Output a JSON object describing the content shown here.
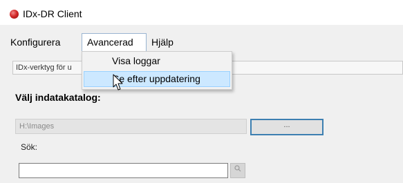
{
  "window": {
    "title": "IDx-DR Client"
  },
  "menubar": {
    "items": [
      {
        "label": "Konfigurera"
      },
      {
        "label": "Avancerad"
      },
      {
        "label": "Hjälp"
      }
    ]
  },
  "dropdown": {
    "items": [
      {
        "label": "Visa loggar",
        "highlighted": false
      },
      {
        "label": "Se efter uppdatering",
        "highlighted": true
      }
    ]
  },
  "toolstrip": {
    "text": "IDx-verktyg för u"
  },
  "main": {
    "section_label": "Välj indatakatalog:",
    "path_value": "H:\\Images",
    "browse_label": "...",
    "search_label": "Sök:",
    "search_value": ""
  },
  "colors": {
    "menu_highlight": "#cce8ff",
    "menu_highlight_border": "#99d1ff",
    "focus_border": "#3c7fb1",
    "app_icon": "#d42a2a"
  },
  "icons": {
    "app": "app-logo-icon",
    "cursor": "mouse-pointer-icon"
  }
}
